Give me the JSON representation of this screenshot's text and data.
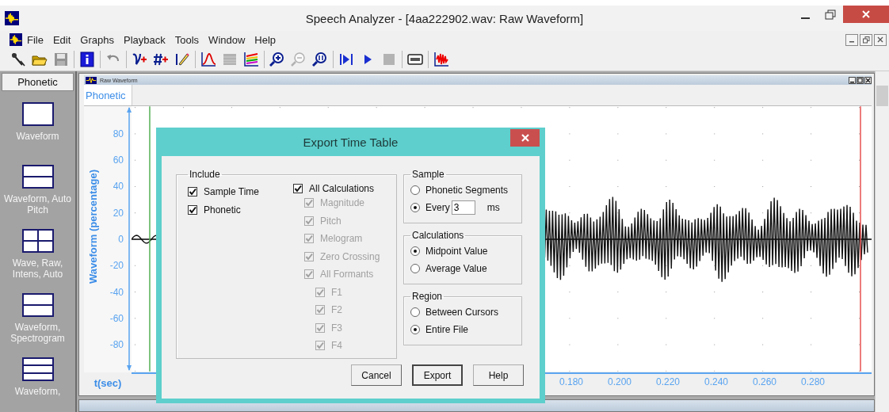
{
  "window": {
    "title": "Speech Analyzer - [4aa222902.wav: Raw Waveform]"
  },
  "menu": [
    "File",
    "Edit",
    "Graphs",
    "Playback",
    "Tools",
    "Window",
    "Help"
  ],
  "toolbar": [
    {
      "kind": "microphone",
      "disabled": false
    },
    {
      "kind": "folder",
      "disabled": false
    },
    {
      "kind": "save",
      "disabled": true
    },
    {
      "kind": "separator"
    },
    {
      "kind": "info",
      "disabled": false
    },
    {
      "kind": "separator"
    },
    {
      "kind": "undo",
      "disabled": true
    },
    {
      "kind": "separator"
    },
    {
      "kind": "curve-plus",
      "disabled": false
    },
    {
      "kind": "hash-plus",
      "disabled": false
    },
    {
      "kind": "pencil",
      "disabled": false
    },
    {
      "kind": "separator"
    },
    {
      "kind": "peak",
      "disabled": false
    },
    {
      "kind": "spectrum",
      "disabled": true
    },
    {
      "kind": "layers",
      "disabled": false
    },
    {
      "kind": "separator"
    },
    {
      "kind": "zoom-in",
      "disabled": false
    },
    {
      "kind": "zoom-out",
      "disabled": true
    },
    {
      "kind": "zoom-fit",
      "disabled": false
    },
    {
      "kind": "separator"
    },
    {
      "kind": "skip",
      "disabled": false
    },
    {
      "kind": "play",
      "disabled": false
    },
    {
      "kind": "stop",
      "disabled": true
    },
    {
      "kind": "separator"
    },
    {
      "kind": "tape",
      "disabled": false
    },
    {
      "kind": "separator"
    },
    {
      "kind": "wave",
      "disabled": false
    }
  ],
  "sidebar": {
    "header": "Phonetic",
    "items": [
      {
        "label": "Waveform",
        "kind": "single"
      },
      {
        "label": "Waveform, Auto Pitch",
        "kind": "split"
      },
      {
        "label": "Wave, Raw, Intens, Auto",
        "kind": "quad"
      },
      {
        "label": "Waveform, Spectrogram",
        "kind": "split"
      },
      {
        "label": "Waveform,",
        "kind": "triple"
      }
    ]
  },
  "child_window": {
    "title": "Raw Waveform",
    "annotation_label": "Phonetic",
    "y_axis": {
      "label": "Waveform (percentage)",
      "ticks": [
        "80",
        "60",
        "40",
        "20",
        "0",
        "-20",
        "-40",
        "-60",
        "-80"
      ]
    },
    "x_axis": {
      "label": "t(sec)",
      "ticks": [
        "0.180",
        "0.200",
        "0.220",
        "0.240",
        "0.260",
        "0.280"
      ]
    }
  },
  "dialog": {
    "title": "Export Time Table",
    "include": {
      "title": "Include",
      "columns": [
        [
          {
            "label": "Sample Time",
            "checked": true,
            "disabled": false
          },
          {
            "label": "Phonetic",
            "checked": true,
            "disabled": false
          }
        ],
        [
          {
            "label": "All Calculations",
            "checked": true,
            "disabled": false,
            "children": [
              {
                "label": "Magnitude",
                "checked": true,
                "disabled": true
              },
              {
                "label": "Pitch",
                "checked": true,
                "disabled": true
              },
              {
                "label": "Melogram",
                "checked": true,
                "disabled": true
              },
              {
                "label": "Zero Crossing",
                "checked": true,
                "disabled": true
              },
              {
                "label": "All Formants",
                "checked": true,
                "disabled": true,
                "children": [
                  {
                    "label": "F1",
                    "checked": true,
                    "disabled": true
                  },
                  {
                    "label": "F2",
                    "checked": true,
                    "disabled": true
                  },
                  {
                    "label": "F3",
                    "checked": true,
                    "disabled": true
                  },
                  {
                    "label": "F4",
                    "checked": true,
                    "disabled": true
                  }
                ]
              }
            ]
          }
        ]
      ]
    },
    "groups": [
      {
        "title": "Sample",
        "options": [
          {
            "label": "Phonetic Segments",
            "selected": false
          },
          {
            "label": "Every",
            "selected": true,
            "value": "3",
            "unit": "ms"
          }
        ]
      },
      {
        "title": "Calculations",
        "options": [
          {
            "label": "Midpoint Value",
            "selected": true
          },
          {
            "label": "Average Value",
            "selected": false
          }
        ]
      },
      {
        "title": "Region",
        "options": [
          {
            "label": "Between Cursors",
            "selected": false
          },
          {
            "label": "Entire File",
            "selected": true
          }
        ]
      }
    ],
    "buttons": [
      {
        "label": "Cancel",
        "default": false
      },
      {
        "label": "Export",
        "default": true
      },
      {
        "label": "Help",
        "default": false
      }
    ]
  }
}
